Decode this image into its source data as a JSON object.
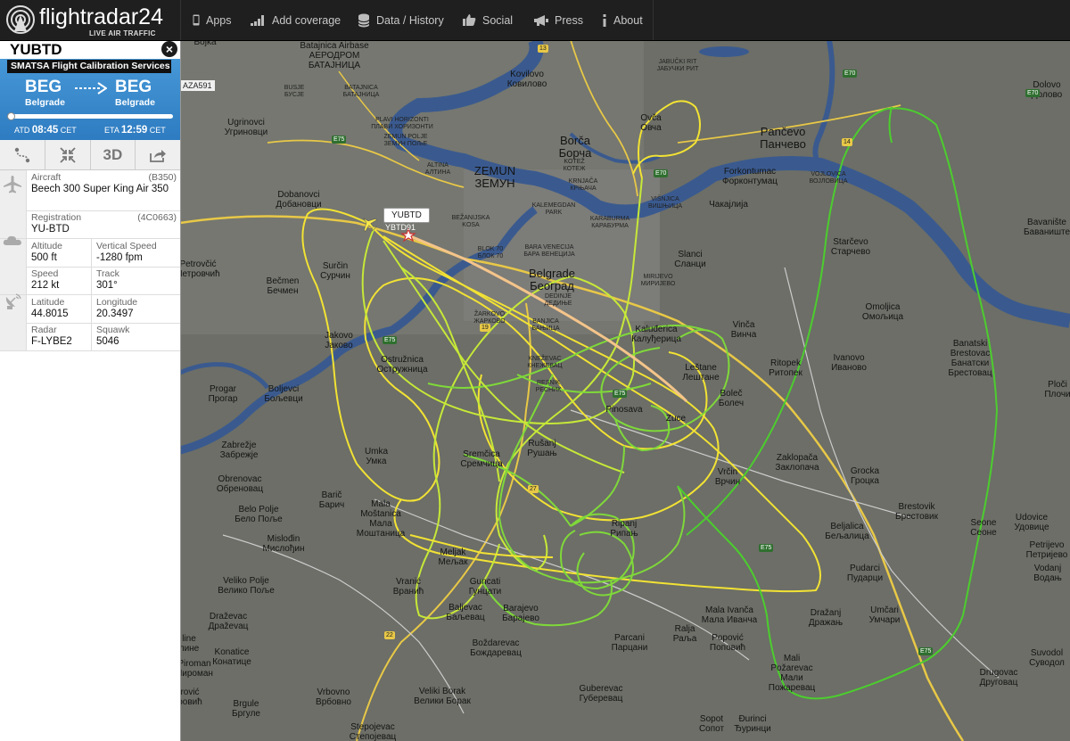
{
  "app": {
    "logo_text": "flightradar24",
    "logo_subtitle": "LIVE AIR TRAFFIC"
  },
  "nav": {
    "items": [
      {
        "label": "Apps",
        "icon": "tablet-icon"
      },
      {
        "label": "Add coverage",
        "icon": "signal-bars-icon"
      },
      {
        "label": "Data / History",
        "icon": "database-icon"
      },
      {
        "label": "Social",
        "icon": "thumbs-up-icon"
      },
      {
        "label": "Press",
        "icon": "megaphone-icon"
      },
      {
        "label": "About",
        "icon": "info-icon"
      }
    ]
  },
  "flight": {
    "callsign": "YUBTD",
    "airline": "SMATSA Flight Calibration Services",
    "origin_code": "BEG",
    "origin_city": "Belgrade",
    "dest_code": "BEG",
    "dest_city": "Belgrade",
    "atd_label": "ATD",
    "atd_time": "08:45",
    "atd_tz": "CET",
    "eta_label": "ETA",
    "eta_time": "12:59",
    "eta_tz": "CET",
    "progress": 0.02,
    "close_glyph": "×"
  },
  "toolbar": {
    "buttons": [
      {
        "name": "route-button",
        "icon": "route-icon"
      },
      {
        "name": "center-button",
        "icon": "compress-arrows-icon"
      },
      {
        "name": "3d-button",
        "label": "3D"
      },
      {
        "name": "share-button",
        "icon": "share-icon"
      }
    ]
  },
  "details": {
    "aircraft_label": "Aircraft",
    "aircraft_code": "(B350)",
    "aircraft_value": "Beech 300 Super King Air 350",
    "registration_label": "Registration",
    "registration_hex": "(4C0663)",
    "registration_value": "YU-BTD",
    "altitude_label": "Altitude",
    "altitude_value": "500 ft",
    "vspeed_label": "Vertical Speed",
    "vspeed_value": "-1280 fpm",
    "speed_label": "Speed",
    "speed_value": "212 kt",
    "track_label": "Track",
    "track_value": "301°",
    "latitude_label": "Latitude",
    "latitude_value": "44.8015",
    "longitude_label": "Longitude",
    "longitude_value": "20.3497",
    "radar_label": "Radar",
    "radar_value": "F-LYBE2",
    "squawk_label": "Squawk",
    "squawk_value": "5046"
  },
  "map": {
    "aircraft_tag": "YUBTD",
    "aircraft_map_label": "YBTD91",
    "other_flight_label": "AZA591",
    "track_colors": [
      "#f2e234",
      "#c6e838",
      "#7fd83a",
      "#4ccd2e"
    ],
    "places": [
      {
        "id": "bojka",
        "lines": [
          "Bojka"
        ]
      },
      {
        "id": "batajnica-airbase",
        "lines": [
          "Batajnica Airbase",
          "АЕРОДРОМ",
          "БАТАЈНИЦА"
        ]
      },
      {
        "id": "busje",
        "lines": [
          "BUSJE",
          "БУСЈЕ"
        ]
      },
      {
        "id": "batajnica",
        "lines": [
          "BATAJNICA",
          "БАТАЈНИЦА"
        ]
      },
      {
        "id": "ugrinovci",
        "lines": [
          "Ugrinovci",
          "Угриновци"
        ]
      },
      {
        "id": "plavi-horizonti",
        "lines": [
          "PLAVI HORIZONTI",
          "ПЛАВИ ХОРИЗОНТИ"
        ]
      },
      {
        "id": "zemun-polje",
        "lines": [
          "ZEMUN POLJE",
          "ЗЕМУН ПОЉЕ"
        ]
      },
      {
        "id": "kovilovo",
        "lines": [
          "Kovilovo",
          "Ковилово"
        ]
      },
      {
        "id": "jabucki-rit",
        "lines": [
          "JABUČKI RIT",
          "ЈАБУЧКИ РИТ"
        ]
      },
      {
        "id": "ovca",
        "lines": [
          "Ovča",
          "Овча"
        ]
      },
      {
        "id": "borca",
        "lines": [
          "Borča",
          "Борча"
        ]
      },
      {
        "id": "kotez",
        "lines": [
          "KOTEŽ",
          "КОТЕЖ"
        ]
      },
      {
        "id": "altina",
        "lines": [
          "ALTINA",
          "АЛТИНА"
        ]
      },
      {
        "id": "zemun",
        "lines": [
          "ZEMUN",
          "ЗЕМУН"
        ]
      },
      {
        "id": "krnjaca",
        "lines": [
          "KRNJAČA",
          "КРЊАЧА"
        ]
      },
      {
        "id": "pancevo",
        "lines": [
          "Pančevo",
          "Панчево"
        ]
      },
      {
        "id": "dolovo",
        "lines": [
          "Dolovo",
          "Долово"
        ]
      },
      {
        "id": "forkontumac",
        "lines": [
          "Forkontumac",
          "Форконтумац"
        ]
      },
      {
        "id": "vojlovica",
        "lines": [
          "VOJLOVICA",
          "ВОЈЛОВИЦА"
        ]
      },
      {
        "id": "cakajlija",
        "lines": [
          "Чакајлија"
        ]
      },
      {
        "id": "dobanovci",
        "lines": [
          "Dobanovci",
          "Добановци"
        ]
      },
      {
        "id": "kalemegdan",
        "lines": [
          "KALEMEGDAN",
          "PARK"
        ]
      },
      {
        "id": "karaburma",
        "lines": [
          "KARABURMA",
          "КАРАБУРМА"
        ]
      },
      {
        "id": "visnjica",
        "lines": [
          "VIŠNJICA",
          "ВИШЊИЦА"
        ]
      },
      {
        "id": "bezanijska-kosa",
        "lines": [
          "BEŽANIJSKA",
          "KOSA"
        ]
      },
      {
        "id": "bara-venecija",
        "lines": [
          "BARA VENECIJA",
          "БАРА ВЕНЕЦИЈА"
        ]
      },
      {
        "id": "slanci",
        "lines": [
          "Slanci",
          "Сланци"
        ]
      },
      {
        "id": "bavaniste",
        "lines": [
          "Bavanište",
          "Баваниште"
        ]
      },
      {
        "id": "starcevo",
        "lines": [
          "Starčevo",
          "Старчево"
        ]
      },
      {
        "id": "petrovcic",
        "lines": [
          "Petrovčić",
          "Петровчић"
        ]
      },
      {
        "id": "surcin",
        "lines": [
          "Surčin",
          "Сурчин"
        ]
      },
      {
        "id": "becmen",
        "lines": [
          "Bečmen",
          "Бечмен"
        ]
      },
      {
        "id": "blok70",
        "lines": [
          "BLOK 70",
          "БЛОК 70"
        ]
      },
      {
        "id": "belgrade",
        "lines": [
          "Belgrade",
          "Београд"
        ]
      },
      {
        "id": "mirijevo",
        "lines": [
          "MIRIJEVO",
          "МИРИЈЕВО"
        ]
      },
      {
        "id": "dedinje",
        "lines": [
          "DEDINJE",
          "ДЕДИЊЕ"
        ]
      },
      {
        "id": "zarkovo",
        "lines": [
          "ŽARKOVO",
          "ЖАРКОВО"
        ]
      },
      {
        "id": "banjica",
        "lines": [
          "BANJICA",
          "БАЊИЦА"
        ]
      },
      {
        "id": "omoljica",
        "lines": [
          "Omoljica",
          "Омољица"
        ]
      },
      {
        "id": "jakovo",
        "lines": [
          "Jakovo",
          "Јаково"
        ]
      },
      {
        "id": "kaludjerica",
        "lines": [
          "Kaluđerica",
          "Калуђерица"
        ]
      },
      {
        "id": "vinca",
        "lines": [
          "Vinča",
          "Винча"
        ]
      },
      {
        "id": "banatski-brestovac",
        "lines": [
          "Banatski",
          "Brestovac",
          "Банатски",
          "Брестовац"
        ]
      },
      {
        "id": "ostruznica",
        "lines": [
          "Ostružnica",
          "Остружница"
        ]
      },
      {
        "id": "knezevac",
        "lines": [
          "KNEŽEVAC",
          "КНЕЖЕВАЦ"
        ]
      },
      {
        "id": "lestane",
        "lines": [
          "Leštane",
          "Лештане"
        ]
      },
      {
        "id": "ritopek",
        "lines": [
          "Ritopek",
          "Ритопек"
        ]
      },
      {
        "id": "ivanovo",
        "lines": [
          "Ivanovo",
          "Иваново"
        ]
      },
      {
        "id": "progar",
        "lines": [
          "Progar",
          "Прогар"
        ]
      },
      {
        "id": "boljevci",
        "lines": [
          "Boljevci",
          "Бољевци"
        ]
      },
      {
        "id": "resnik",
        "lines": [
          "RESNIK",
          "РЕСНИК"
        ]
      },
      {
        "id": "pinosava",
        "lines": [
          "Pinosava"
        ]
      },
      {
        "id": "zuce",
        "lines": [
          "Zuce"
        ]
      },
      {
        "id": "bolec",
        "lines": [
          "Boleč",
          "Болеч"
        ]
      },
      {
        "id": "plociste",
        "lines": [
          "Ploči",
          "Плочи"
        ]
      },
      {
        "id": "zabrezje",
        "lines": [
          "Zabrežje",
          "Забрежје"
        ]
      },
      {
        "id": "umka",
        "lines": [
          "Umka",
          "Умка"
        ]
      },
      {
        "id": "rusanj",
        "lines": [
          "Rušanj",
          "Рушањ"
        ]
      },
      {
        "id": "sremcica",
        "lines": [
          "Sremčica",
          "Сремчица"
        ]
      },
      {
        "id": "vrcin",
        "lines": [
          "Vrčin",
          "Врчин"
        ]
      },
      {
        "id": "zaklopaca",
        "lines": [
          "Zaklopača",
          "Заклопача"
        ]
      },
      {
        "id": "grocka",
        "lines": [
          "Grocka",
          "Гроцка"
        ]
      },
      {
        "id": "obrenovac",
        "lines": [
          "Obrenovac",
          "Обреновац"
        ]
      },
      {
        "id": "baric",
        "lines": [
          "Barič",
          "Барич"
        ]
      },
      {
        "id": "mala-mostanica",
        "lines": [
          "Mala",
          "Moštanica",
          "Мала",
          "Моштаница"
        ]
      },
      {
        "id": "ripanj",
        "lines": [
          "Ripanj",
          "Рипањ"
        ]
      },
      {
        "id": "brestovik",
        "lines": [
          "Brestovik",
          "Брестовик"
        ]
      },
      {
        "id": "seone",
        "lines": [
          "Seone",
          "Сеоне"
        ]
      },
      {
        "id": "udovice",
        "lines": [
          "Udovice",
          "Удовице"
        ]
      },
      {
        "id": "belo-polje",
        "lines": [
          "Belo Polje",
          "Бело Поље"
        ]
      },
      {
        "id": "mislodjin",
        "lines": [
          "Mislođin",
          "Мислођин"
        ]
      },
      {
        "id": "beljalica",
        "lines": [
          "Beljalica",
          "Бељалица"
        ]
      },
      {
        "id": "petrijevo",
        "lines": [
          "Petrijevo",
          "Петријево"
        ]
      },
      {
        "id": "meljak",
        "lines": [
          "Meljak",
          "Мељак"
        ]
      },
      {
        "id": "pudarci",
        "lines": [
          "Pudarci",
          "Пударци"
        ]
      },
      {
        "id": "vodanj",
        "lines": [
          "Vodanj",
          "Водањ"
        ]
      },
      {
        "id": "veliko-polje",
        "lines": [
          "Veliko Polje",
          "Велико Поље"
        ]
      },
      {
        "id": "vranic",
        "lines": [
          "Vranić",
          "Вранић"
        ]
      },
      {
        "id": "guncati",
        "lines": [
          "Guncati",
          "Гунцати"
        ]
      },
      {
        "id": "baljevac",
        "lines": [
          "Baljevac",
          "Баљевац"
        ]
      },
      {
        "id": "barajevo",
        "lines": [
          "Barajevo",
          "Барајево"
        ]
      },
      {
        "id": "mala-ivanca",
        "lines": [
          "Mala Ivanča",
          "Мала Иванча"
        ]
      },
      {
        "id": "drazanj",
        "lines": [
          "Dražanj",
          "Дражањ"
        ]
      },
      {
        "id": "umcari",
        "lines": [
          "Umčari",
          "Умчари"
        ]
      },
      {
        "id": "drazevac",
        "lines": [
          "Draževac",
          "Драževац"
        ]
      },
      {
        "id": "ralja",
        "lines": [
          "Ralja",
          "Раља"
        ]
      },
      {
        "id": "parcani",
        "lines": [
          "Parcani",
          "Парцани"
        ]
      },
      {
        "id": "popovic",
        "lines": [
          "Popović",
          "Поповић"
        ]
      },
      {
        "id": "konatice",
        "lines": [
          "Konatice",
          "Конатице"
        ]
      },
      {
        "id": "bozdarevac",
        "lines": [
          "Boždarevac",
          "Бождаревац"
        ]
      },
      {
        "id": "mali-pozarevac",
        "lines": [
          "Mali",
          "Požarevac",
          "Мали",
          "Пожаревац"
        ]
      },
      {
        "id": "suvodol",
        "lines": [
          "Suvodol",
          "Суводол"
        ]
      },
      {
        "id": "drugovac",
        "lines": [
          "Drugovac",
          "Друговац"
        ]
      },
      {
        "id": "vrbovno",
        "lines": [
          "Vrbovno",
          "Врбовно"
        ]
      },
      {
        "id": "veliki-borak",
        "lines": [
          "Veliki Borak",
          "Велики Борак"
        ]
      },
      {
        "id": "guberevac",
        "lines": [
          "Guberevac",
          "Губеревац"
        ]
      },
      {
        "id": "brgule",
        "lines": [
          "Brgule",
          "Бргуле"
        ]
      },
      {
        "id": "sopot",
        "lines": [
          "Sopot",
          "Сопот"
        ]
      },
      {
        "id": "duringi",
        "lines": [
          "Đurinci",
          "Ђуринци"
        ]
      },
      {
        "id": "stepojevac",
        "lines": [
          "Stepojevac",
          "Степојевац"
        ]
      },
      {
        "id": "beljina",
        "lines": [
          "Beljina",
          "Бељина"
        ]
      },
      {
        "id": "iline",
        "lines": [
          "line",
          "лине"
        ]
      },
      {
        "id": "piroman",
        "lines": [
          "Piroman",
          "Пироман"
        ]
      },
      {
        "id": "brovic",
        "lines": [
          "rović",
          "ровић"
        ]
      }
    ],
    "road_badges": [
      "13",
      "E70",
      "E75",
      "E70",
      "14",
      "E75",
      "19",
      "E75",
      "27",
      "22",
      "E75",
      "E75",
      "E70"
    ]
  }
}
